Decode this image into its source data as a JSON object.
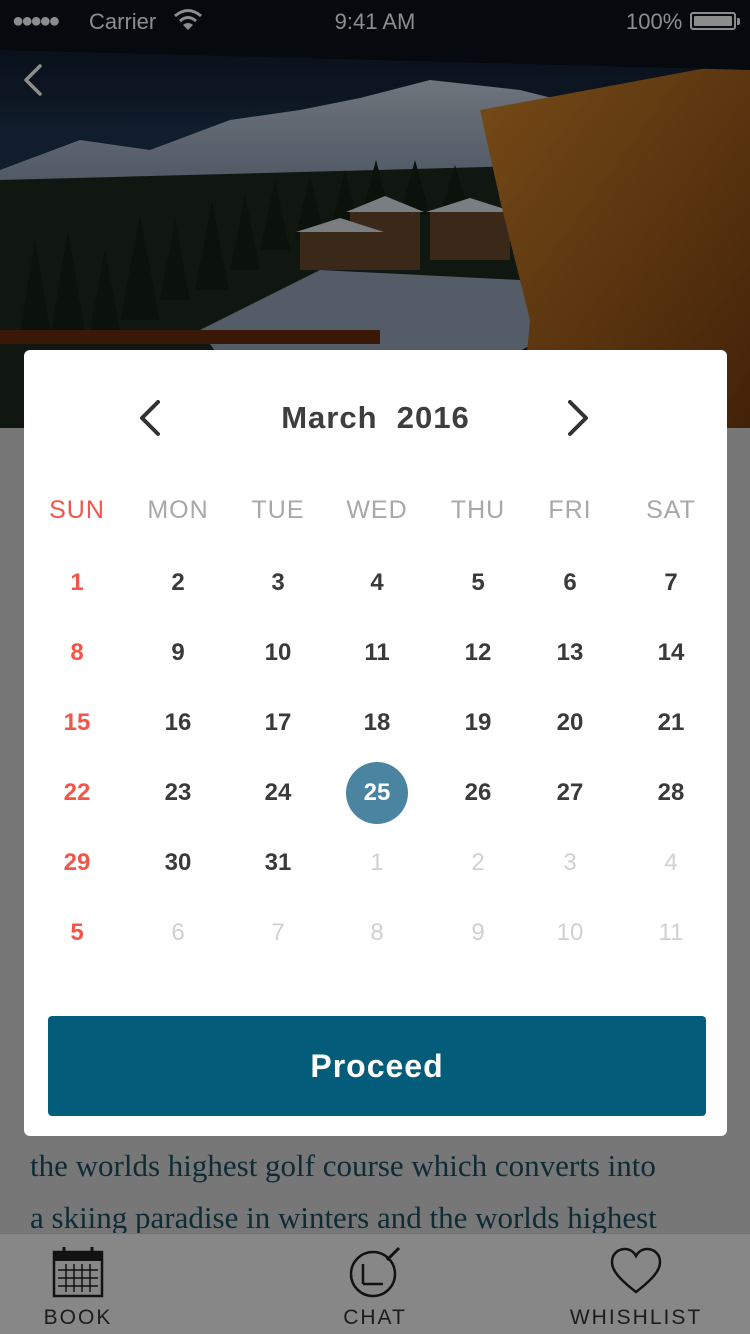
{
  "status_bar": {
    "signal": "●●●●●",
    "carrier": "Carrier",
    "time": "9:41 AM",
    "battery": "100%"
  },
  "article": {
    "lines": [
      "the worlds highest golf course which converts into",
      "a skiing paradise in winters and the worlds highest"
    ]
  },
  "tab_bar": {
    "book": "BOOK",
    "chat": "CHAT",
    "wishlist": "WHISHLIST"
  },
  "calendar": {
    "month": "March",
    "year": "2016",
    "weekdays": [
      "SUN",
      "MON",
      "TUE",
      "WED",
      "THU",
      "FRI",
      "SAT"
    ],
    "selected_day": "25",
    "weeks": [
      [
        "1",
        "2",
        "3",
        "4",
        "5",
        "6",
        "7"
      ],
      [
        "8",
        "9",
        "10",
        "11",
        "12",
        "13",
        "14"
      ],
      [
        "15",
        "16",
        "17",
        "18",
        "19",
        "20",
        "21"
      ],
      [
        "22",
        "23",
        "24",
        "25",
        "26",
        "27",
        "28"
      ],
      [
        "29",
        "30",
        "31",
        "1",
        "2",
        "3",
        "4"
      ],
      [
        "5",
        "6",
        "7",
        "8",
        "9",
        "10",
        "11"
      ]
    ],
    "outside_month": [
      [
        4,
        3
      ],
      [
        4,
        4
      ],
      [
        4,
        5
      ],
      [
        4,
        6
      ],
      [
        5,
        1
      ],
      [
        5,
        2
      ],
      [
        5,
        3
      ],
      [
        5,
        4
      ],
      [
        5,
        5
      ],
      [
        5,
        6
      ]
    ],
    "proceed_label": "Proceed"
  },
  "colors": {
    "accent": "#035c7a",
    "selected": "#4a84a0",
    "sunday": "#f2564a",
    "muted": "#d0d0d0"
  }
}
